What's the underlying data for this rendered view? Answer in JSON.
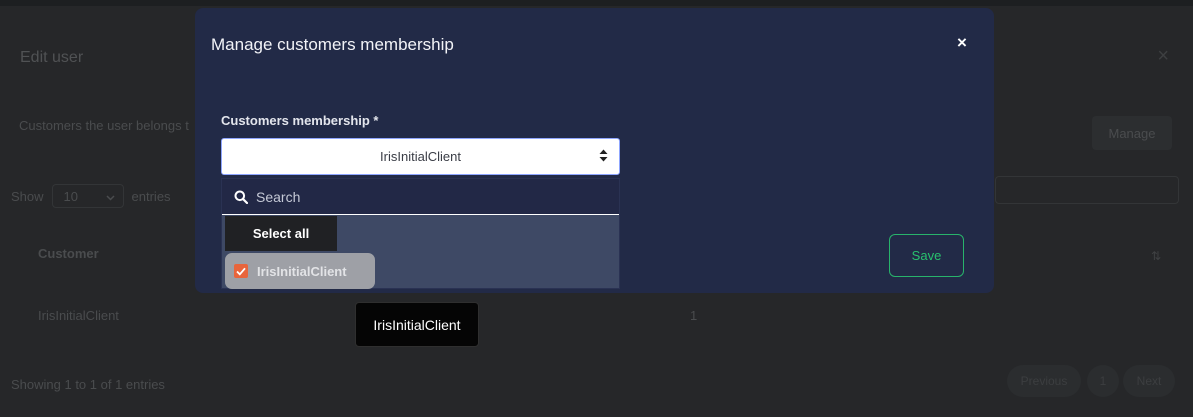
{
  "background": {
    "title": "Edit user",
    "close_symbol": "×",
    "description": "Customers the user belongs t",
    "manage_label": "Manage",
    "show_label": "Show",
    "page_length_value": "10",
    "entries_label": "entries",
    "column_customer": "Customer",
    "row_customer": "IrisInitialClient",
    "row_value": "1",
    "footer_text": "Showing 1 to 1 of 1 entries",
    "pagination": {
      "previous": "Previous",
      "page": "1",
      "next": "Next"
    }
  },
  "modal": {
    "title": "Manage customers membership",
    "close_symbol": "×",
    "field_label": "Customers membership *",
    "selected_value": "IrisInitialClient",
    "search_placeholder": "Search",
    "select_all_label": "Select all",
    "options": [
      {
        "label": "IrisInitialClient",
        "checked": true
      }
    ],
    "save_label": "Save"
  },
  "tooltip": {
    "text": "IrisInitialClient"
  },
  "colors": {
    "modal_bg": "#222a47",
    "save_accent": "#28b36b",
    "checkbox_accent": "#e8653c",
    "select_border": "#8fa6ff"
  },
  "icons": [
    "close-icon",
    "search-icon",
    "select-caret-icon",
    "checkmark-icon",
    "sort-icon",
    "chevron-down-icon"
  ]
}
